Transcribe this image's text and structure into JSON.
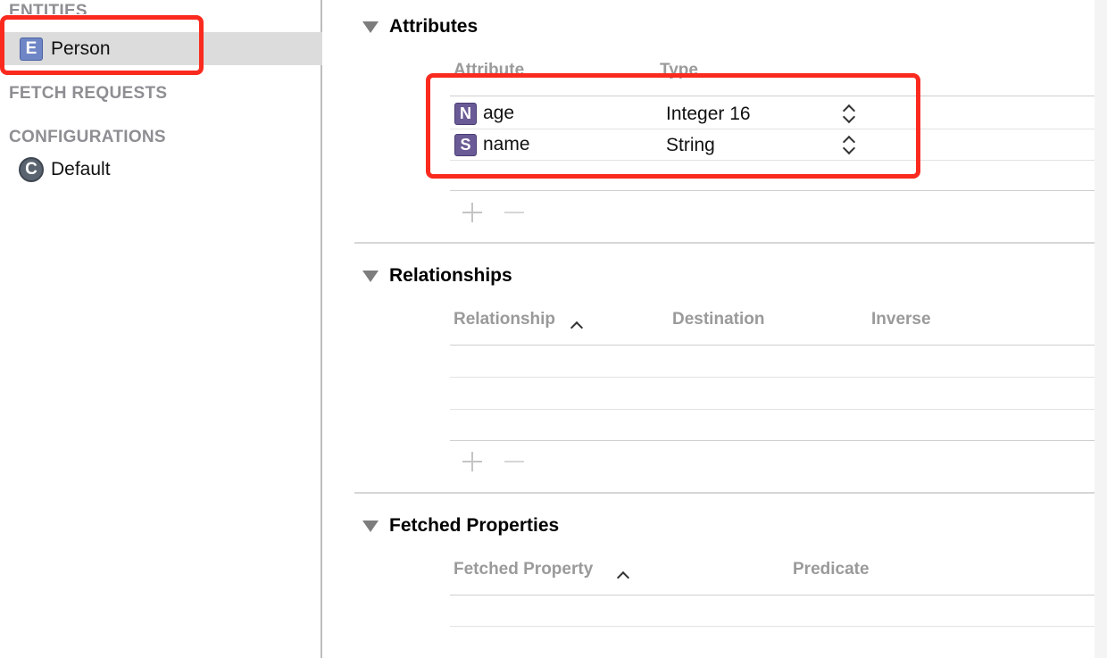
{
  "sidebar": {
    "entities_header": "ENTITIES",
    "entities": [
      {
        "icon": "entity-icon",
        "icon_letter": "E",
        "label": "Person"
      }
    ],
    "fetch_requests_header": "FETCH REQUESTS",
    "configurations_header": "CONFIGURATIONS",
    "configurations": [
      {
        "icon": "configuration-icon",
        "icon_letter": "C",
        "label": "Default"
      }
    ]
  },
  "attributes": {
    "title": "Attributes",
    "columns": [
      "Attribute",
      "Type"
    ],
    "rows": [
      {
        "icon": "number-type-icon",
        "icon_letter": "N",
        "name": "age",
        "type": "Integer 16"
      },
      {
        "icon": "string-type-icon",
        "icon_letter": "S",
        "name": "name",
        "type": "String"
      }
    ]
  },
  "relationships": {
    "title": "Relationships",
    "columns": [
      "Relationship",
      "Destination",
      "Inverse"
    ]
  },
  "fetched_properties": {
    "title": "Fetched Properties",
    "columns": [
      "Fetched Property",
      "Predicate"
    ]
  },
  "colors": {
    "highlight": "#fa2a1f",
    "selection": "#dcdcdc"
  }
}
